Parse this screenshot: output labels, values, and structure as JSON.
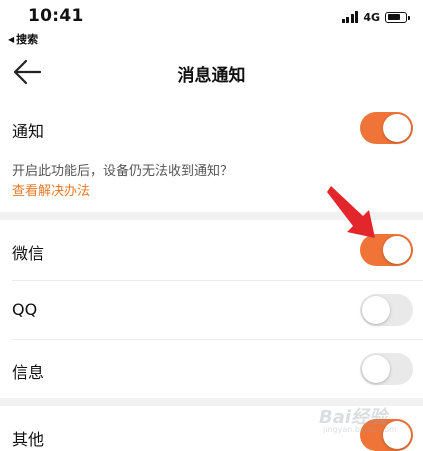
{
  "status_bar": {
    "time": "10:41",
    "network": "4G",
    "battery_level": 0.75,
    "signal_bars": 4
  },
  "back_app_label": "搜索",
  "nav": {
    "title": "消息通知"
  },
  "rows": [
    {
      "label": "通知",
      "on": true
    },
    {
      "label": "微信",
      "on": true
    },
    {
      "label": "QQ",
      "on": false
    },
    {
      "label": "信息",
      "on": false
    },
    {
      "label": "其他",
      "on": true
    }
  ],
  "hint": {
    "text": "开启此功能后，设备仍无法收到通知？",
    "link": "查看解决办法"
  },
  "watermark": {
    "text": "Bai经验",
    "sub": "jingyan.baidu.com"
  },
  "colors": {
    "accent": "#f07437",
    "link": "#e8792a",
    "arrow": "#e3262b"
  }
}
